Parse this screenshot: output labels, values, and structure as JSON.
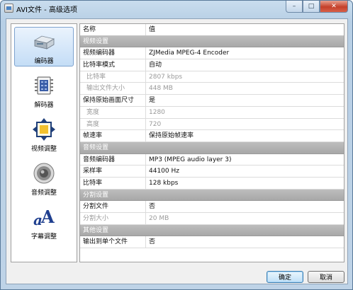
{
  "window": {
    "title": "AVI文件 - 高级选项",
    "controls": {
      "minimize": "–",
      "maximize": "□",
      "close": "✕"
    }
  },
  "sidebar": {
    "items": [
      {
        "label": "编码器",
        "icon": "encoder-drive-icon",
        "selected": true
      },
      {
        "label": "解码器",
        "icon": "decoder-chip-icon",
        "selected": false
      },
      {
        "label": "视频调整",
        "icon": "video-adjust-icon",
        "selected": false
      },
      {
        "label": "音频调整",
        "icon": "speaker-icon",
        "selected": false
      },
      {
        "label": "字幕调整",
        "icon": "subtitle-letters-icon",
        "selected": false
      }
    ]
  },
  "grid": {
    "headers": {
      "name": "名称",
      "value": "值"
    },
    "rows": [
      {
        "type": "category",
        "name": "视频设置"
      },
      {
        "name": "视频编码器",
        "value": "ZJMedia MPEG-4 Encoder"
      },
      {
        "name": "比特率模式",
        "value": "自动"
      },
      {
        "name": "比特率",
        "value": "2807 kbps",
        "disabled": true,
        "indent": true
      },
      {
        "name": "输出文件大小",
        "value": "448 MB",
        "disabled": true,
        "indent": true
      },
      {
        "name": "保持原始画面尺寸",
        "value": "是"
      },
      {
        "name": "宽度",
        "value": "1280",
        "disabled": true,
        "indent": true
      },
      {
        "name": "高度",
        "value": "720",
        "disabled": true,
        "indent": true
      },
      {
        "name": "帧速率",
        "value": "保持原始帧速率"
      },
      {
        "type": "category",
        "name": "音频设置"
      },
      {
        "name": "音频编码器",
        "value": "MP3 (MPEG audio layer 3)"
      },
      {
        "name": "采样率",
        "value": "44100 Hz"
      },
      {
        "name": "比特率",
        "value": "128 kbps"
      },
      {
        "type": "category",
        "name": "分割设置"
      },
      {
        "name": "分割文件",
        "value": "否"
      },
      {
        "name": "分割大小",
        "value": "20 MB",
        "disabled": true
      },
      {
        "type": "category",
        "name": "其他设置"
      },
      {
        "name": "输出到单个文件",
        "value": "否"
      }
    ]
  },
  "buttons": {
    "ok": "确定",
    "cancel": "取消"
  },
  "colors": {
    "accent": "#3c7fb1",
    "category_bg": "#a8a8a8",
    "selected_bg": "#c4ddf6",
    "close_red": "#c4402a"
  }
}
